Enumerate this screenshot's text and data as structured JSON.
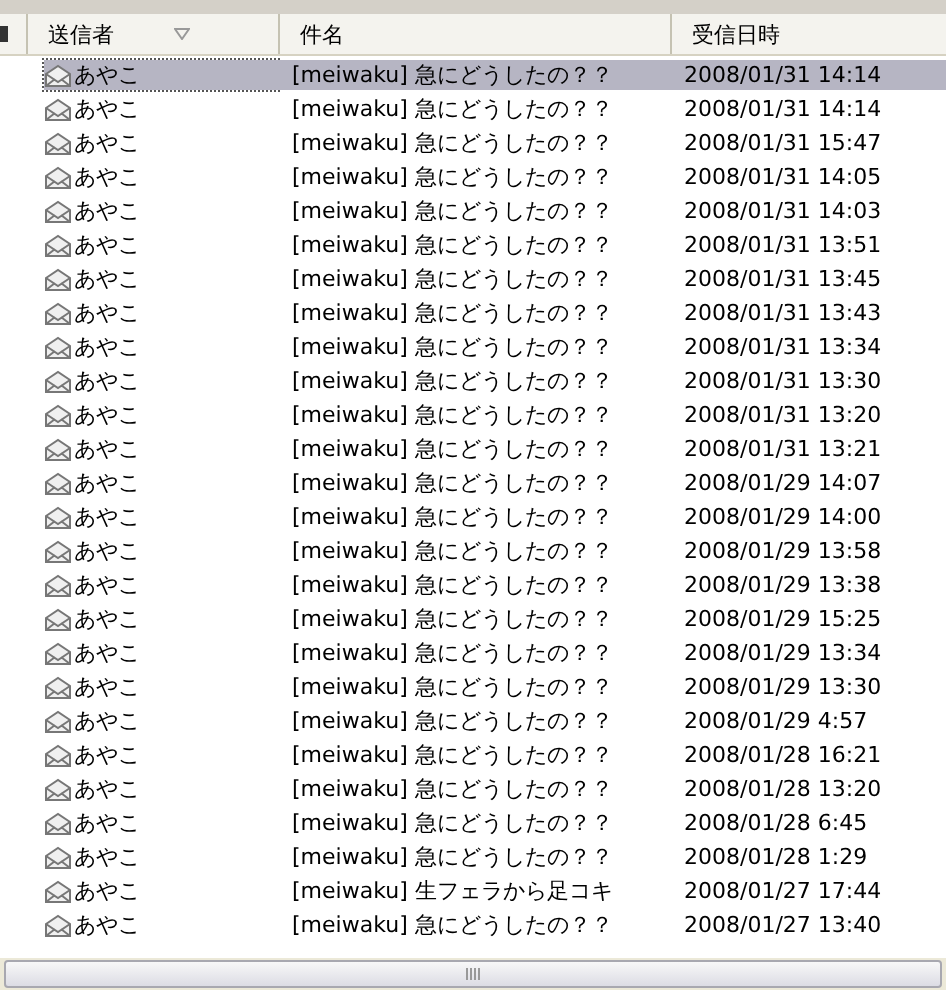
{
  "columns": [
    {
      "label": "送信者",
      "sorted": true
    },
    {
      "label": "件名",
      "sorted": false
    },
    {
      "label": "受信日時",
      "sorted": false
    }
  ],
  "rows": [
    {
      "sender": "あやこ",
      "subject": "[meiwaku] 急にどうしたの？？",
      "received": "2008/01/31 14:14",
      "selected": true
    },
    {
      "sender": "あやこ",
      "subject": "[meiwaku] 急にどうしたの？？",
      "received": "2008/01/31 14:14",
      "selected": false
    },
    {
      "sender": "あやこ",
      "subject": "[meiwaku] 急にどうしたの？？",
      "received": "2008/01/31 15:47",
      "selected": false
    },
    {
      "sender": "あやこ",
      "subject": "[meiwaku] 急にどうしたの？？",
      "received": "2008/01/31 14:05",
      "selected": false
    },
    {
      "sender": "あやこ",
      "subject": "[meiwaku] 急にどうしたの？？",
      "received": "2008/01/31 14:03",
      "selected": false
    },
    {
      "sender": "あやこ",
      "subject": "[meiwaku] 急にどうしたの？？",
      "received": "2008/01/31 13:51",
      "selected": false
    },
    {
      "sender": "あやこ",
      "subject": "[meiwaku] 急にどうしたの？？",
      "received": "2008/01/31 13:45",
      "selected": false
    },
    {
      "sender": "あやこ",
      "subject": "[meiwaku] 急にどうしたの？？",
      "received": "2008/01/31 13:43",
      "selected": false
    },
    {
      "sender": "あやこ",
      "subject": "[meiwaku] 急にどうしたの？？",
      "received": "2008/01/31 13:34",
      "selected": false
    },
    {
      "sender": "あやこ",
      "subject": "[meiwaku] 急にどうしたの？？",
      "received": "2008/01/31 13:30",
      "selected": false
    },
    {
      "sender": "あやこ",
      "subject": "[meiwaku] 急にどうしたの？？",
      "received": "2008/01/31 13:20",
      "selected": false
    },
    {
      "sender": "あやこ",
      "subject": "[meiwaku] 急にどうしたの？？",
      "received": "2008/01/31 13:21",
      "selected": false
    },
    {
      "sender": "あやこ",
      "subject": "[meiwaku] 急にどうしたの？？",
      "received": "2008/01/29 14:07",
      "selected": false
    },
    {
      "sender": "あやこ",
      "subject": "[meiwaku] 急にどうしたの？？",
      "received": "2008/01/29 14:00",
      "selected": false
    },
    {
      "sender": "あやこ",
      "subject": "[meiwaku] 急にどうしたの？？",
      "received": "2008/01/29 13:58",
      "selected": false
    },
    {
      "sender": "あやこ",
      "subject": "[meiwaku] 急にどうしたの？？",
      "received": "2008/01/29 13:38",
      "selected": false
    },
    {
      "sender": "あやこ",
      "subject": "[meiwaku] 急にどうしたの？？",
      "received": "2008/01/29 15:25",
      "selected": false
    },
    {
      "sender": "あやこ",
      "subject": "[meiwaku] 急にどうしたの？？",
      "received": "2008/01/29 13:34",
      "selected": false
    },
    {
      "sender": "あやこ",
      "subject": "[meiwaku] 急にどうしたの？？",
      "received": "2008/01/29 13:30",
      "selected": false
    },
    {
      "sender": "あやこ",
      "subject": "[meiwaku] 急にどうしたの？？",
      "received": "2008/01/29 4:57",
      "selected": false
    },
    {
      "sender": "あやこ",
      "subject": "[meiwaku] 急にどうしたの？？",
      "received": "2008/01/28 16:21",
      "selected": false
    },
    {
      "sender": "あやこ",
      "subject": "[meiwaku] 急にどうしたの？？",
      "received": "2008/01/28 13:20",
      "selected": false
    },
    {
      "sender": "あやこ",
      "subject": "[meiwaku] 急にどうしたの？？",
      "received": "2008/01/28 6:45",
      "selected": false
    },
    {
      "sender": "あやこ",
      "subject": "[meiwaku] 急にどうしたの？？",
      "received": "2008/01/28 1:29",
      "selected": false
    },
    {
      "sender": "あやこ",
      "subject": "[meiwaku] 生フェラから足コキ",
      "received": "2008/01/27 17:44",
      "selected": false
    },
    {
      "sender": "あやこ",
      "subject": "[meiwaku] 急にどうしたの？？",
      "received": "2008/01/27 13:40",
      "selected": false
    }
  ]
}
